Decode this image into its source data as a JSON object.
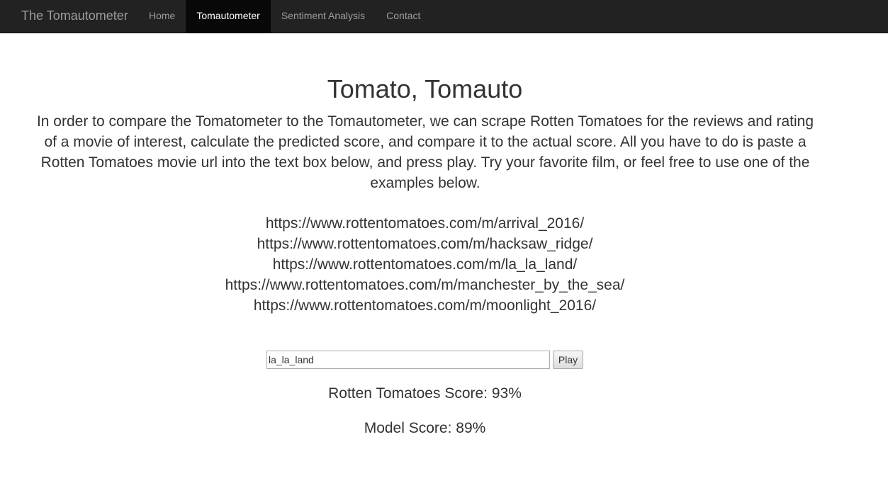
{
  "navbar": {
    "brand": "The Tomautometer",
    "items": [
      {
        "label": "Home",
        "active": false
      },
      {
        "label": "Tomautometer",
        "active": true
      },
      {
        "label": "Sentiment Analysis",
        "active": false
      },
      {
        "label": "Contact",
        "active": false
      }
    ]
  },
  "main": {
    "title": "Tomato, Tomauto",
    "intro": "In order to compare the Tomatometer to the Tomautometer, we can scrape Rotten Tomatoes for the reviews and rating of a movie of interest, calculate the predicted score, and compare it to the actual score. All you have to do is paste a Rotten Tomatoes movie url into the text box below, and press play. Try your favorite film, or feel free to use one of the examples below.",
    "examples": [
      "https://www.rottentomatoes.com/m/arrival_2016/",
      "https://www.rottentomatoes.com/m/hacksaw_ridge/",
      "https://www.rottentomatoes.com/m/la_la_land/",
      "https://www.rottentomatoes.com/m/manchester_by_the_sea/",
      "https://www.rottentomatoes.com/m/moonlight_2016/"
    ],
    "form": {
      "input_value": "la_la_land",
      "play_label": "Play"
    },
    "rt_score": "Rotten Tomatoes Score: 93%",
    "model_score": "Model Score: 89%"
  }
}
